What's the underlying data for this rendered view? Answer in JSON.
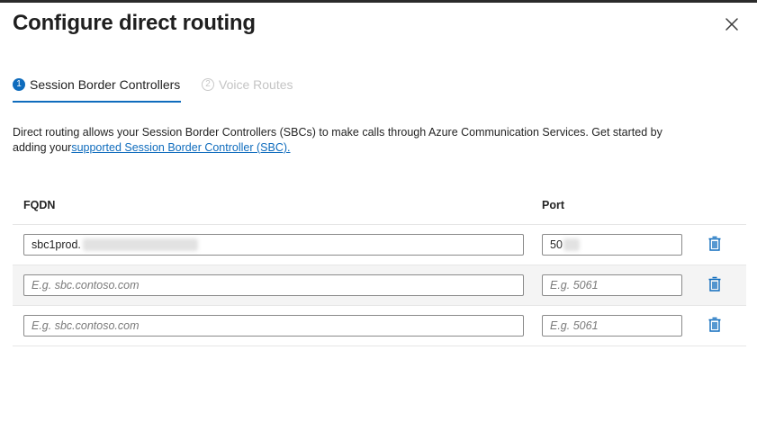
{
  "dialog": {
    "title": "Configure direct routing"
  },
  "steps": [
    {
      "number": "1",
      "label": "Session Border Controllers",
      "active": true
    },
    {
      "number": "2",
      "label": "Voice Routes",
      "active": false
    }
  ],
  "description": {
    "text": "Direct routing allows your Session Border Controllers (SBCs) to make calls through Azure Communication Services. Get started by adding your",
    "link_text": "supported Session Border Controller (SBC)."
  },
  "table": {
    "columns": {
      "fqdn": "FQDN",
      "port": "Port"
    },
    "rows": [
      {
        "fqdn_value": "sbc1prod.",
        "port_value": "50",
        "fqdn_placeholder": "E.g. sbc.contoso.com",
        "port_placeholder": "E.g. 5061"
      },
      {
        "fqdn_value": "",
        "port_value": "",
        "fqdn_placeholder": "E.g. sbc.contoso.com",
        "port_placeholder": "E.g. 5061"
      },
      {
        "fqdn_value": "",
        "port_value": "",
        "fqdn_placeholder": "E.g. sbc.contoso.com",
        "port_placeholder": "E.g. 5061"
      }
    ]
  },
  "icons": {
    "close": "close-icon",
    "delete": "trash-icon"
  },
  "colors": {
    "accent": "#0f6cbd",
    "text": "#1f1f1f",
    "disabled": "#c4c4c4",
    "row_highlight": "#f4f4f4"
  }
}
